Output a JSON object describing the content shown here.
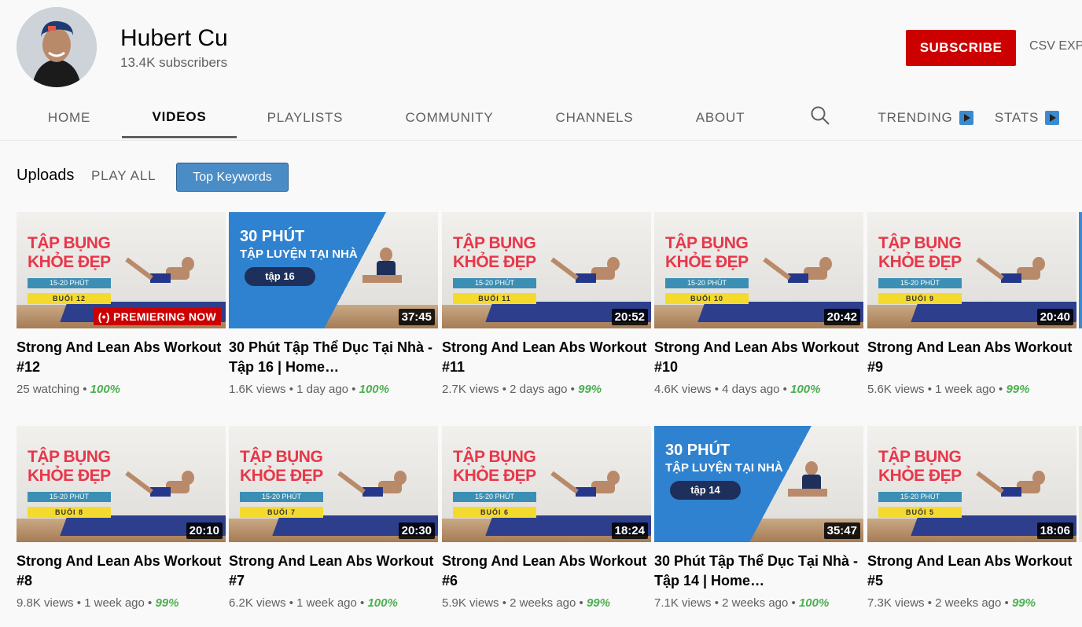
{
  "channel": {
    "name": "Hubert Cu",
    "subscribers": "13.4K subscribers",
    "subscribe_label": "SUBSCRIBE",
    "csv_label": "CSV EXPO"
  },
  "tabs": [
    {
      "label": "HOME"
    },
    {
      "label": "VIDEOS"
    },
    {
      "label": "PLAYLISTS"
    },
    {
      "label": "COMMUNITY"
    },
    {
      "label": "CHANNELS"
    },
    {
      "label": "ABOUT"
    },
    {
      "label": "TRENDING"
    },
    {
      "label": "STATS"
    }
  ],
  "section": {
    "title": "Uploads",
    "play_all": "PLAY ALL",
    "top_keywords": "Top Keywords"
  },
  "colors": {
    "accent": "#cc0000",
    "link_blue": "#4a8cc6",
    "percent_green": "#4caf50"
  },
  "videos": [
    {
      "title": "Strong And Lean Abs Workout #12",
      "meta": "25 watching",
      "percent": "100%",
      "badge": "(•) PREMIERING NOW",
      "thumb": "abs",
      "tag": "BUỔI 12"
    },
    {
      "title": "30 Phút Tập Thể Dục Tại Nhà - Tập 16 | Home…",
      "meta": "1.6K views • 1 day ago",
      "percent": "100%",
      "duration": "37:45",
      "thumb": "blue",
      "ep": "tập 16"
    },
    {
      "title": "Strong And Lean Abs Workout #11",
      "meta": "2.7K views • 2 days ago",
      "percent": "99%",
      "duration": "20:52",
      "thumb": "abs",
      "tag": "BUỔI 11"
    },
    {
      "title": "Strong And Lean Abs Workout #10",
      "meta": "4.6K views • 4 days ago",
      "percent": "100%",
      "duration": "20:42",
      "thumb": "abs",
      "tag": "BUỔI 10"
    },
    {
      "title": "Strong And Lean Abs Workout #9",
      "meta": "5.6K views • 1 week ago",
      "percent": "99%",
      "duration": "20:40",
      "thumb": "abs",
      "tag": "BUỔI 9"
    },
    {
      "title": "Strong And Lean Abs Workout #8",
      "meta": "9.8K views • 1 week ago",
      "percent": "99%",
      "duration": "20:10",
      "thumb": "abs",
      "tag": "BUỔI 8"
    },
    {
      "title": "Strong And Lean Abs Workout #7",
      "meta": "6.2K views • 1 week ago",
      "percent": "100%",
      "duration": "20:30",
      "thumb": "abs",
      "tag": "BUỔI 7"
    },
    {
      "title": "Strong And Lean Abs Workout #6",
      "meta": "5.9K views • 2 weeks ago",
      "percent": "99%",
      "duration": "18:24",
      "thumb": "abs",
      "tag": "BUỔI 6"
    },
    {
      "title": "30 Phút Tập Thể Dục Tại Nhà - Tập 14 | Home…",
      "meta": "7.1K views • 2 weeks ago",
      "percent": "100%",
      "duration": "35:47",
      "thumb": "blue",
      "ep": "tập 14"
    },
    {
      "title": "Strong And Lean Abs Workout #5",
      "meta": "7.3K views • 2 weeks ago",
      "percent": "99%",
      "duration": "18:06",
      "thumb": "abs",
      "tag": "BUỔI 5"
    }
  ],
  "thumb_text": {
    "abs_line1": "TẬP BỤNG",
    "abs_line2": "KHỎE ĐẸP",
    "abs_strip": "15-20 PHÚT",
    "blue_line1": "30 PHÚT",
    "blue_line2": "TẬP LUYỆN TẠI NHÀ"
  }
}
